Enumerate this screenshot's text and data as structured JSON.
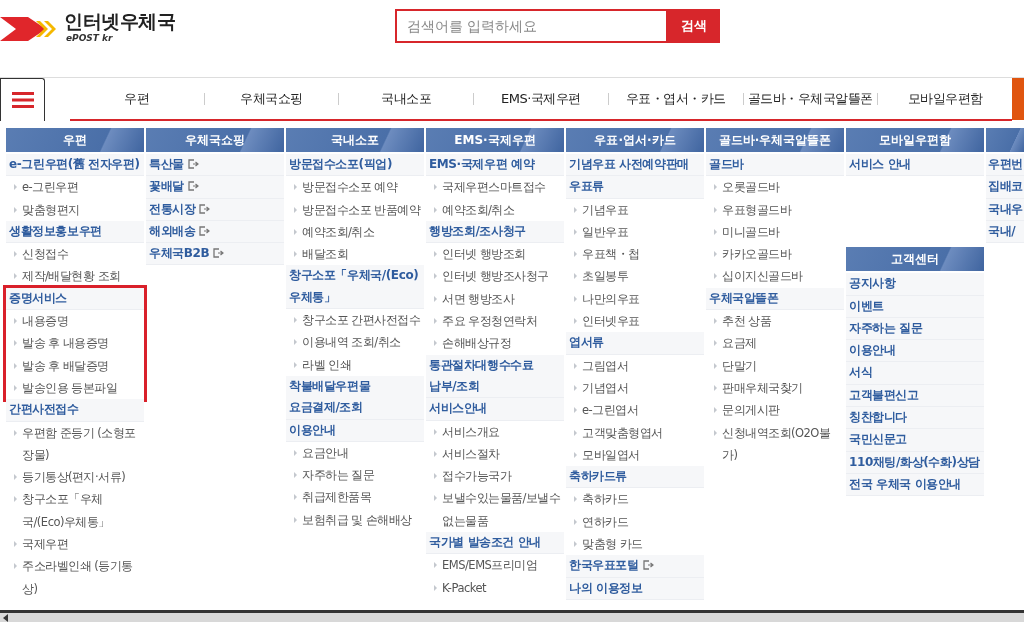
{
  "logo": {
    "title": "인터넷우체국",
    "subtitle": "ePOST kr"
  },
  "search": {
    "placeholder": "검색어를 입력하세요",
    "button": "검색"
  },
  "nav": {
    "items": [
      "우편",
      "우체국쇼핑",
      "국내소포",
      "EMS·국제우편",
      "우표・엽서・카드",
      "골드바・우체국알뜰폰",
      "모바일우편함"
    ]
  },
  "columns": [
    {
      "blocks": [
        {
          "title": "우편",
          "sections": [
            {
              "heading": "e-그린우편(舊 전자우편)",
              "external": false,
              "highlighted": false,
              "items": [
                "e-그린우편",
                "맞춤형편지"
              ]
            },
            {
              "heading": "생활정보홍보우편",
              "external": false,
              "highlighted": false,
              "items": [
                "신청접수",
                "제작/배달현황 조회"
              ]
            },
            {
              "heading": "증명서비스",
              "external": false,
              "highlighted": true,
              "items": [
                "내용증명",
                "발송 후 내용증명",
                "발송 후 배달증명",
                "발송인용 등본파일"
              ]
            },
            {
              "heading": "간편사전접수",
              "external": false,
              "highlighted": false,
              "items": [
                "우편함 준등기 (소형포장물)",
                "등기통상(편지·서류)",
                "창구소포「우체국/(Eco)우체통」",
                "국제우편",
                "주소라벨인쇄 (등기통상)"
              ]
            }
          ]
        }
      ]
    },
    {
      "blocks": [
        {
          "title": "우체국쇼핑",
          "sections": [
            {
              "heading": "특산물",
              "external": true,
              "highlighted": false
            },
            {
              "heading": "꽃배달",
              "external": true,
              "highlighted": false
            },
            {
              "heading": "전통시장",
              "external": true,
              "highlighted": false
            },
            {
              "heading": "해외배송",
              "external": true,
              "highlighted": false
            },
            {
              "heading": "우체국B2B",
              "external": true,
              "highlighted": false
            }
          ]
        }
      ]
    },
    {
      "blocks": [
        {
          "title": "국내소포",
          "sections": [
            {
              "heading": "방문접수소포(픽업)",
              "external": false,
              "highlighted": false,
              "items": [
                "방문접수소포 예약",
                "방문접수소포 반품예약",
                "예약조회/취소",
                "배달조회"
              ]
            },
            {
              "heading": "창구소포「우체국/(Eco)우체통」",
              "external": false,
              "highlighted": false,
              "items": [
                "창구소포 간편사전접수",
                "이용내역 조회/취소",
                "라벨 인쇄"
              ]
            },
            {
              "heading": "착불배달우편물 요금결제/조회",
              "external": false,
              "highlighted": false
            },
            {
              "heading": "이용안내",
              "external": false,
              "highlighted": false,
              "items": [
                "요금안내",
                "자주하는 질문",
                "취급제한품목",
                "보험취급 및 손해배상"
              ]
            }
          ]
        }
      ]
    },
    {
      "blocks": [
        {
          "title": "EMS·국제우편",
          "sections": [
            {
              "heading": "EMS·국제우편 예약",
              "external": false,
              "highlighted": false,
              "items": [
                "국제우편스마트접수",
                "예약조회/취소"
              ]
            },
            {
              "heading": "행방조회/조사청구",
              "external": false,
              "highlighted": false,
              "items": [
                "인터넷 행방조회",
                "인터넷 행방조사청구",
                "서면 행방조사",
                "주요 우정청연락처",
                "손해배상규정"
              ]
            },
            {
              "heading": "통관절차대행수수료 납부/조회",
              "external": false,
              "highlighted": false
            },
            {
              "heading": "서비스안내",
              "external": false,
              "highlighted": false,
              "items": [
                "서비스개요",
                "서비스절차",
                "접수가능국가",
                "보낼수있는물품/보낼수없는물품"
              ]
            },
            {
              "heading": "국가별 발송조건 안내",
              "external": false,
              "highlighted": false,
              "items": [
                "EMS/EMS프리미엄",
                "K-Packet"
              ]
            }
          ]
        }
      ]
    },
    {
      "blocks": [
        {
          "title": "우표·엽서·카드",
          "sections": [
            {
              "heading": "기념우표 사전예약판매",
              "external": false,
              "highlighted": false
            },
            {
              "heading": "우표류",
              "external": false,
              "highlighted": false,
              "items": [
                "기념우표",
                "일반우표",
                "우표책・첩",
                "초일봉투",
                "나만의우표",
                "인터넷우표"
              ]
            },
            {
              "heading": "엽서류",
              "external": false,
              "highlighted": false,
              "items": [
                "그림엽서",
                "기념엽서",
                "e-그린엽서",
                "고객맞춤형엽서",
                "모바일엽서"
              ]
            },
            {
              "heading": "축하카드류",
              "external": false,
              "highlighted": false,
              "items": [
                "축하카드",
                "연하카드",
                "맞춤형 카드"
              ]
            },
            {
              "heading": "한국우표포털",
              "external": true,
              "highlighted": false
            },
            {
              "heading": "나의 이용정보",
              "external": false,
              "highlighted": false
            }
          ]
        }
      ]
    },
    {
      "blocks": [
        {
          "title": "골드바·우체국알뜰폰",
          "sections": [
            {
              "heading": "골드바",
              "external": false,
              "highlighted": false,
              "items": [
                "오롯골드바",
                "우표형골드바",
                "미니골드바",
                "카카오골드바",
                "십이지신골드바"
              ]
            },
            {
              "heading": "우체국알뜰폰",
              "external": false,
              "highlighted": false,
              "items": [
                "추천 상품",
                "요금제",
                "단말기",
                "판매우체국찾기",
                "문의게시판",
                "신청내역조회(O2O불가)"
              ]
            }
          ]
        }
      ]
    },
    {
      "blocks": [
        {
          "title": "모바일우편함",
          "sections": [
            {
              "heading": "서비스 안내",
              "external": false,
              "highlighted": false
            }
          ]
        },
        {
          "title": "고객센터",
          "sections": [
            {
              "heading": "공지사항",
              "external": false,
              "highlighted": false
            },
            {
              "heading": "이벤트",
              "external": false,
              "highlighted": false
            },
            {
              "heading": "자주하는 질문",
              "external": false,
              "highlighted": false
            },
            {
              "heading": "이용안내",
              "external": false,
              "highlighted": false
            },
            {
              "heading": "서식",
              "external": false,
              "highlighted": false
            },
            {
              "heading": "고객불편신고",
              "external": false,
              "highlighted": false
            },
            {
              "heading": "칭찬합니다",
              "external": false,
              "highlighted": false
            },
            {
              "heading": "국민신문고",
              "external": false,
              "highlighted": false
            },
            {
              "heading": "110채팅/화상(수화)상담",
              "external": false,
              "highlighted": false
            },
            {
              "heading": "전국 우체국 이용안내",
              "external": false,
              "highlighted": false
            }
          ]
        }
      ]
    },
    {
      "blocks": [
        {
          "sections": [
            {
              "heading": "우편번",
              "external": false,
              "highlighted": false
            },
            {
              "heading": "집배코",
              "external": false,
              "highlighted": false
            },
            {
              "heading": "국내우",
              "external": false,
              "highlighted": false
            },
            {
              "heading": "국내/",
              "external": false,
              "highlighted": false
            }
          ]
        }
      ]
    }
  ]
}
